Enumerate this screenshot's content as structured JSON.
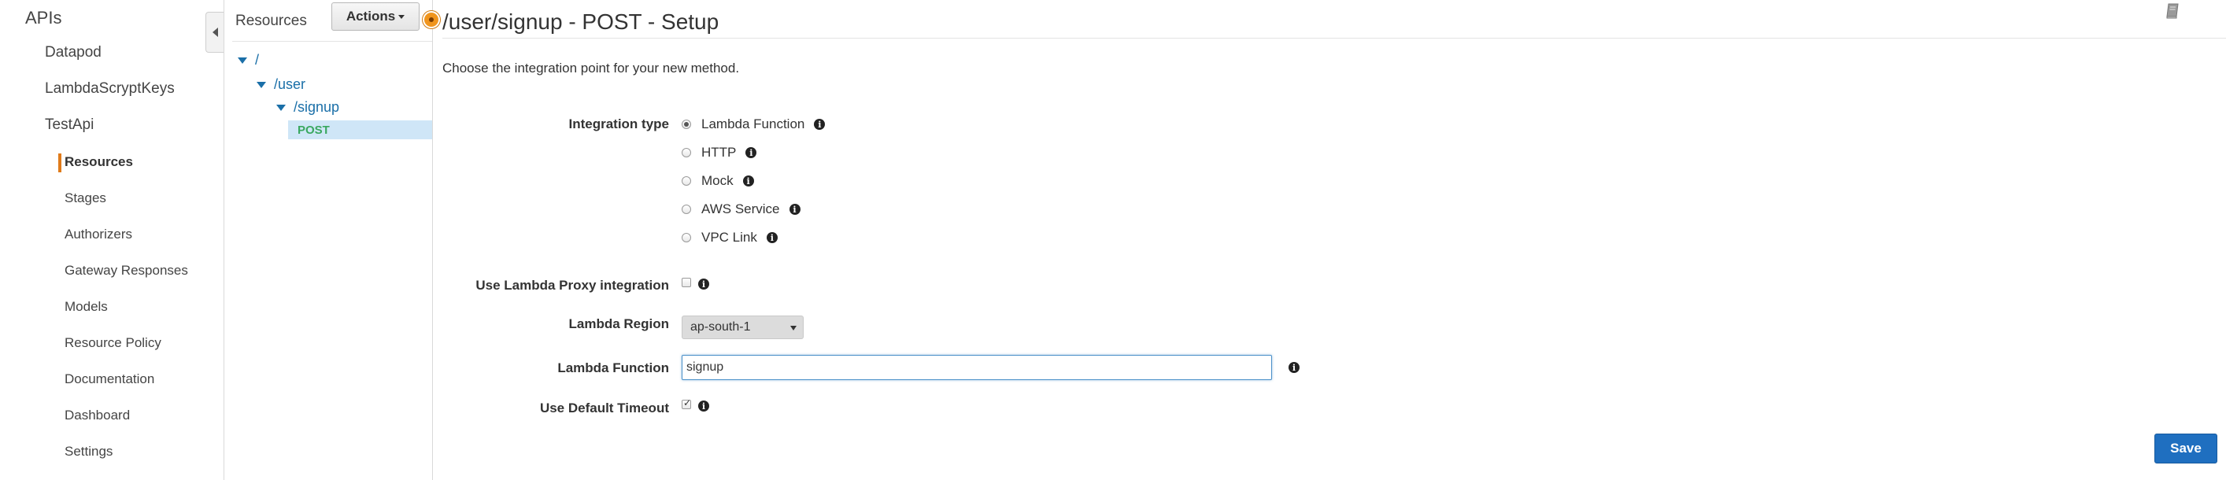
{
  "nav": {
    "apis_label": "APIs",
    "items": [
      {
        "label": "Datapod"
      },
      {
        "label": "LambdaScryptKeys"
      },
      {
        "label": "TestApi"
      }
    ],
    "sub_items": [
      {
        "label": "Resources",
        "active": true
      },
      {
        "label": "Stages"
      },
      {
        "label": "Authorizers"
      },
      {
        "label": "Gateway Responses"
      },
      {
        "label": "Models"
      },
      {
        "label": "Resource Policy"
      },
      {
        "label": "Documentation"
      },
      {
        "label": "Dashboard"
      },
      {
        "label": "Settings"
      }
    ],
    "accent_color": "#e07b1a"
  },
  "resources": {
    "title": "Resources",
    "actions_label": "Actions",
    "tree": [
      {
        "label": "/"
      },
      {
        "label": "/user"
      },
      {
        "label": "/signup"
      }
    ],
    "selected_method": "POST",
    "method_color": "#3aa860",
    "link_color": "#1a6fa8"
  },
  "main": {
    "title": "/user/signup - POST - Setup",
    "subtitle": "Choose the integration point for your new method.",
    "integration_type_label": "Integration type",
    "integration_options": [
      {
        "label": "Lambda Function",
        "selected": true
      },
      {
        "label": "HTTP",
        "selected": false
      },
      {
        "label": "Mock",
        "selected": false
      },
      {
        "label": "AWS Service",
        "selected": false
      },
      {
        "label": "VPC Link",
        "selected": false
      }
    ],
    "proxy_label": "Use Lambda Proxy integration",
    "proxy_checked": false,
    "region_label": "Lambda Region",
    "region_value": "ap-south-1",
    "function_label": "Lambda Function",
    "function_value": "signup",
    "timeout_label": "Use Default Timeout",
    "timeout_checked": true,
    "save_label": "Save",
    "save_color": "#1f6fc0",
    "help_icon": "book-icon",
    "info_icon": "info-icon"
  }
}
